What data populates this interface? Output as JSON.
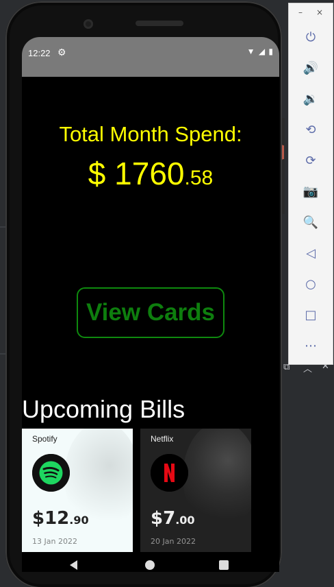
{
  "status_bar": {
    "time": "12:22",
    "icons": "▼◢▮"
  },
  "summary": {
    "label": "Total Month Spend:",
    "currency": "$",
    "amount_whole": "1760",
    "amount_cents": ".58"
  },
  "view_cards_label": "View Cards",
  "bills_title": "Upcoming Bills",
  "bills": [
    {
      "name": "Spotify",
      "amount_whole": "$12",
      "amount_cents": ".90",
      "date": "13 Jan 2022",
      "logo": "spotify-logo",
      "accent": "#1ed760"
    },
    {
      "name": "Netflix",
      "amount_whole": "$7",
      "amount_cents": ".00",
      "date": "20 Jan 2022",
      "logo": "netflix-logo",
      "accent": "#e50914"
    }
  ],
  "emulator": {
    "controls": [
      "power",
      "volume-up",
      "volume-down",
      "rotate-left",
      "rotate-right",
      "screenshot",
      "zoom",
      "back",
      "home",
      "overview",
      "more"
    ],
    "minimize": "–",
    "close": "×"
  },
  "colors": {
    "spend_text": "#ffff00",
    "view_cards": "#0e7e0e",
    "bills_title": "#ffffff",
    "status_bar": "#7a7a7a"
  }
}
